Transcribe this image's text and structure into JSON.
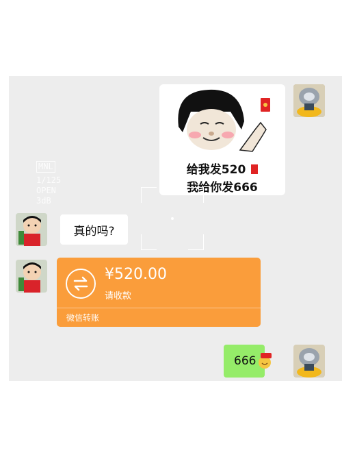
{
  "sticker": {
    "line1": "给我发520",
    "line2": "我给你发666"
  },
  "overlay": {
    "tag": "MNL",
    "l1": "1/125",
    "l2": "OPEN",
    "l3": "3dB"
  },
  "messages": {
    "question": "真的吗?",
    "reply": "666"
  },
  "transfer": {
    "amount": "¥520.00",
    "status": "请收款",
    "footer": "微信转账"
  },
  "colors": {
    "chat_bg": "#ededed",
    "transfer": "#fa9d3b",
    "self_bubble": "#95ec69"
  }
}
